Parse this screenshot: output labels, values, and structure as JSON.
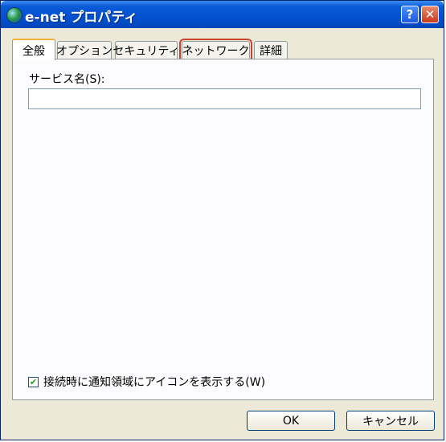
{
  "window": {
    "title": "e-net プロパティ",
    "help_label": "?",
    "close_label": "✕"
  },
  "tabs": [
    {
      "label": "全般",
      "active": true
    },
    {
      "label": "オプション",
      "active": false
    },
    {
      "label": "セキュリティ",
      "active": false
    },
    {
      "label": "ネットワーク",
      "active": false,
      "highlighted": true
    },
    {
      "label": "詳細",
      "active": false
    }
  ],
  "general": {
    "service_name_label": "サービス名(S):",
    "service_name_value": "",
    "notify_icon_checkbox": {
      "label": "接続時に通知領域にアイコンを表示する(W)",
      "checked": true,
      "check_mark": "✔"
    }
  },
  "buttons": {
    "ok": "OK",
    "cancel": "キャンセル"
  },
  "colors": {
    "highlight_outline": "#c8452a",
    "titlebar": "#0350d1"
  }
}
